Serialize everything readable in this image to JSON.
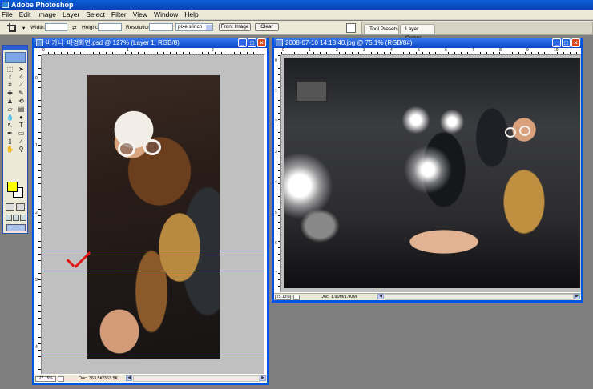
{
  "app": {
    "title": "Adobe Photoshop"
  },
  "menu": [
    "File",
    "Edit",
    "Image",
    "Layer",
    "Select",
    "Filter",
    "View",
    "Window",
    "Help"
  ],
  "options_bar": {
    "width_label": "Width:",
    "height_label": "Height:",
    "resolution_label": "Resolution:",
    "units_value": "pixels/inch",
    "front_image_label": "Front Image",
    "clear_label": "Clear"
  },
  "palette_well": {
    "tabs": [
      "Tool Presets",
      "Layer Comps"
    ]
  },
  "toolbox": {
    "tools": [
      "marquee",
      "move",
      "lasso",
      "magic-wand",
      "crop",
      "slice",
      "healing",
      "brush",
      "stamp",
      "history-brush",
      "eraser",
      "gradient",
      "blur",
      "dodge",
      "path-select",
      "type",
      "pen",
      "shape",
      "notes",
      "eyedropper",
      "hand",
      "zoom"
    ],
    "foreground_color": "#ffff00",
    "background_color": "#ffffff"
  },
  "doc1": {
    "title": "바카니_배경화면.psd @ 127% (Layer 1, RGB/8)",
    "zoom": "127.15%",
    "doc_size": "Doc: 363.5K/363.5K",
    "ruler_top": [
      "0",
      "1",
      "2"
    ],
    "ruler_left": [
      "0",
      "1",
      "2",
      "3",
      "4"
    ]
  },
  "doc2": {
    "title": "2008-07-10 14:18:40.jpg @ 75.1% (RGB/8#)",
    "zoom": "75.13%",
    "doc_size": "Doc: 1.90M/1.90M",
    "ruler_top": [
      "0",
      "1",
      "2",
      "3",
      "4",
      "5",
      "6",
      "7",
      "8",
      "9",
      "10"
    ],
    "ruler_left": [
      "0",
      "1",
      "2",
      "3",
      "4",
      "5",
      "6",
      "7"
    ]
  },
  "colors": {
    "titlebar": "#0a48c7",
    "chrome": "#ece9d8",
    "workspace": "#7f7f7f",
    "guide": "#5fd6e6",
    "checkmark": "#e01818"
  }
}
